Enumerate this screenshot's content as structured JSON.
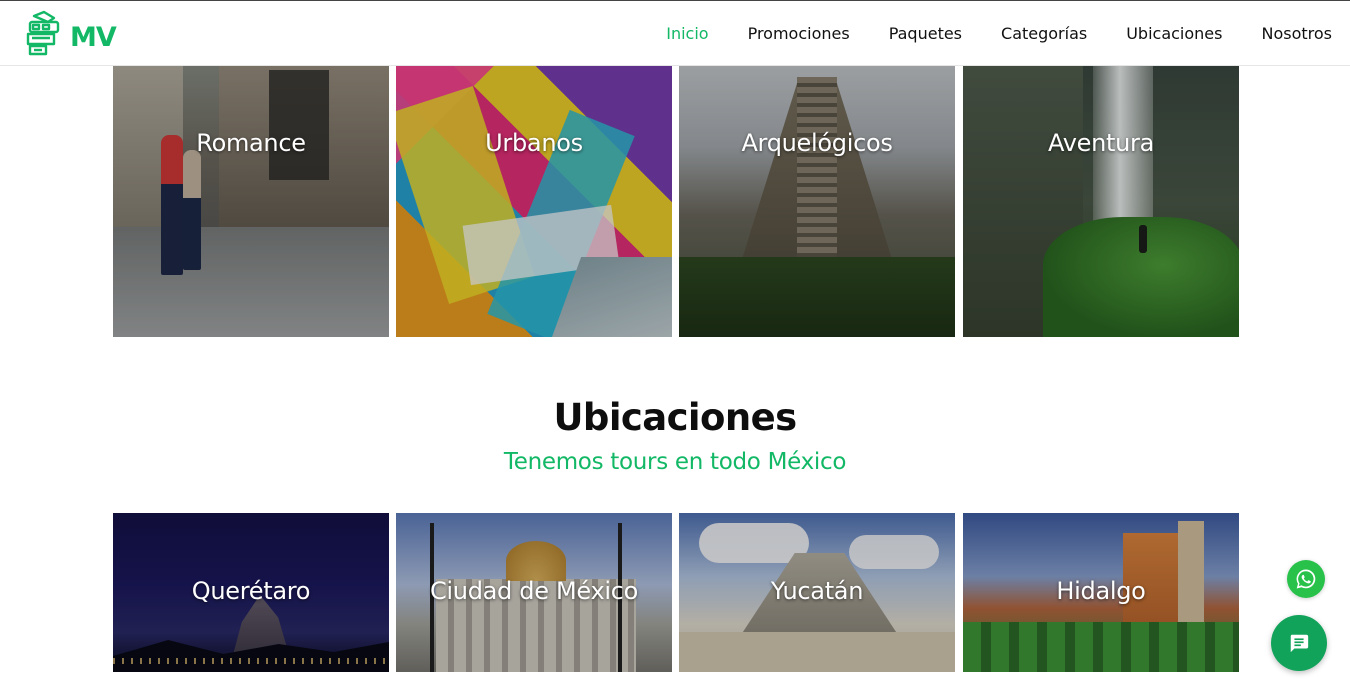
{
  "brand": {
    "logo_text": "MV",
    "color": "#12b865"
  },
  "nav": {
    "items": [
      {
        "label": "Inicio",
        "active": true
      },
      {
        "label": "Promociones",
        "active": false
      },
      {
        "label": "Paquetes",
        "active": false
      },
      {
        "label": "Categorías",
        "active": false
      },
      {
        "label": "Ubicaciones",
        "active": false
      },
      {
        "label": "Nosotros",
        "active": false
      }
    ]
  },
  "categories": [
    {
      "label": "Romance"
    },
    {
      "label": "Urbanos"
    },
    {
      "label": "Arquelógicos"
    },
    {
      "label": "Aventura"
    }
  ],
  "locations_section": {
    "title": "Ubicaciones",
    "subtitle": "Tenemos tours en todo México",
    "items": [
      {
        "label": "Querétaro"
      },
      {
        "label": "Ciudad de México"
      },
      {
        "label": "Yucatán"
      },
      {
        "label": "Hidalgo"
      }
    ]
  },
  "floating": {
    "whatsapp_icon": "whatsapp-icon",
    "chat_icon": "chat-icon",
    "whatsapp_color": "#28c24b",
    "chat_color": "#11a35a"
  }
}
